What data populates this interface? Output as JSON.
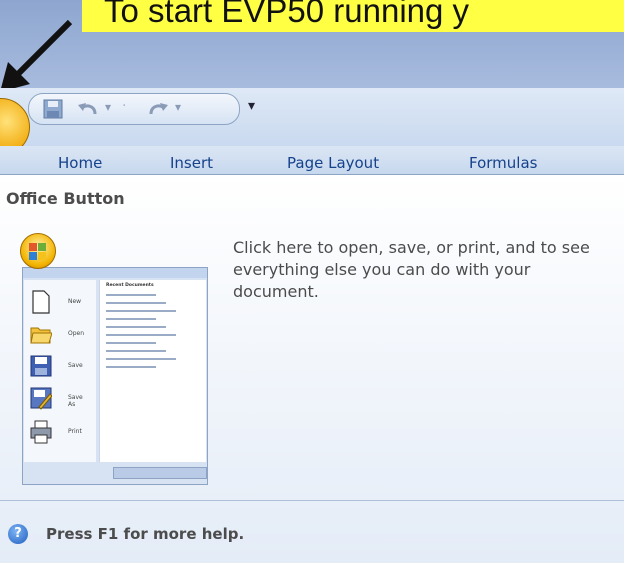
{
  "banner": {
    "text": "To start EVP50 running y"
  },
  "qat": {
    "dropdown_glyph": "▾"
  },
  "tabs": [
    "Home",
    "Insert",
    "Page Layout",
    "Formulas"
  ],
  "tooltip": {
    "title": "Office Button",
    "description": "Click here to open, save, or print, and to see everything else you can do with your document.",
    "help": "Press F1 for more help.",
    "help_glyph": "?"
  },
  "thumbnail": {
    "menu": [
      "New",
      "Open",
      "Save",
      "Save As",
      "Print"
    ],
    "recent_header": "Recent Documents",
    "recent_count": 10
  }
}
